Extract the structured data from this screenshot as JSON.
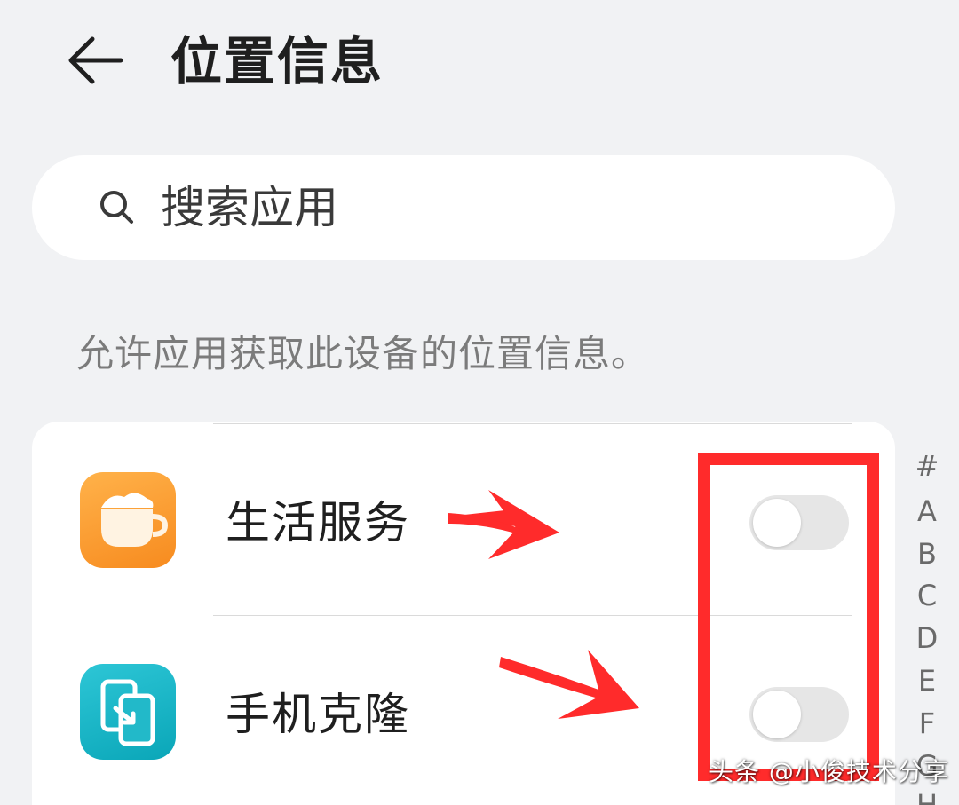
{
  "header": {
    "title": "位置信息"
  },
  "search": {
    "placeholder": "搜索应用"
  },
  "description": "允许应用获取此设备的位置信息。",
  "apps": [
    {
      "label": "生活服务",
      "icon": "cup-icon",
      "location_enabled": false
    },
    {
      "label": "手机克隆",
      "icon": "phone-clone-icon",
      "location_enabled": false
    }
  ],
  "index_letters": [
    "#",
    "A",
    "B",
    "C",
    "D",
    "E",
    "F",
    "G",
    "H"
  ],
  "watermark": "头条 @小俊技术分享",
  "colors": {
    "background": "#f1f2f4",
    "annotation_red": "#ff2b2b",
    "toggle_off": "#e6e6e6"
  }
}
